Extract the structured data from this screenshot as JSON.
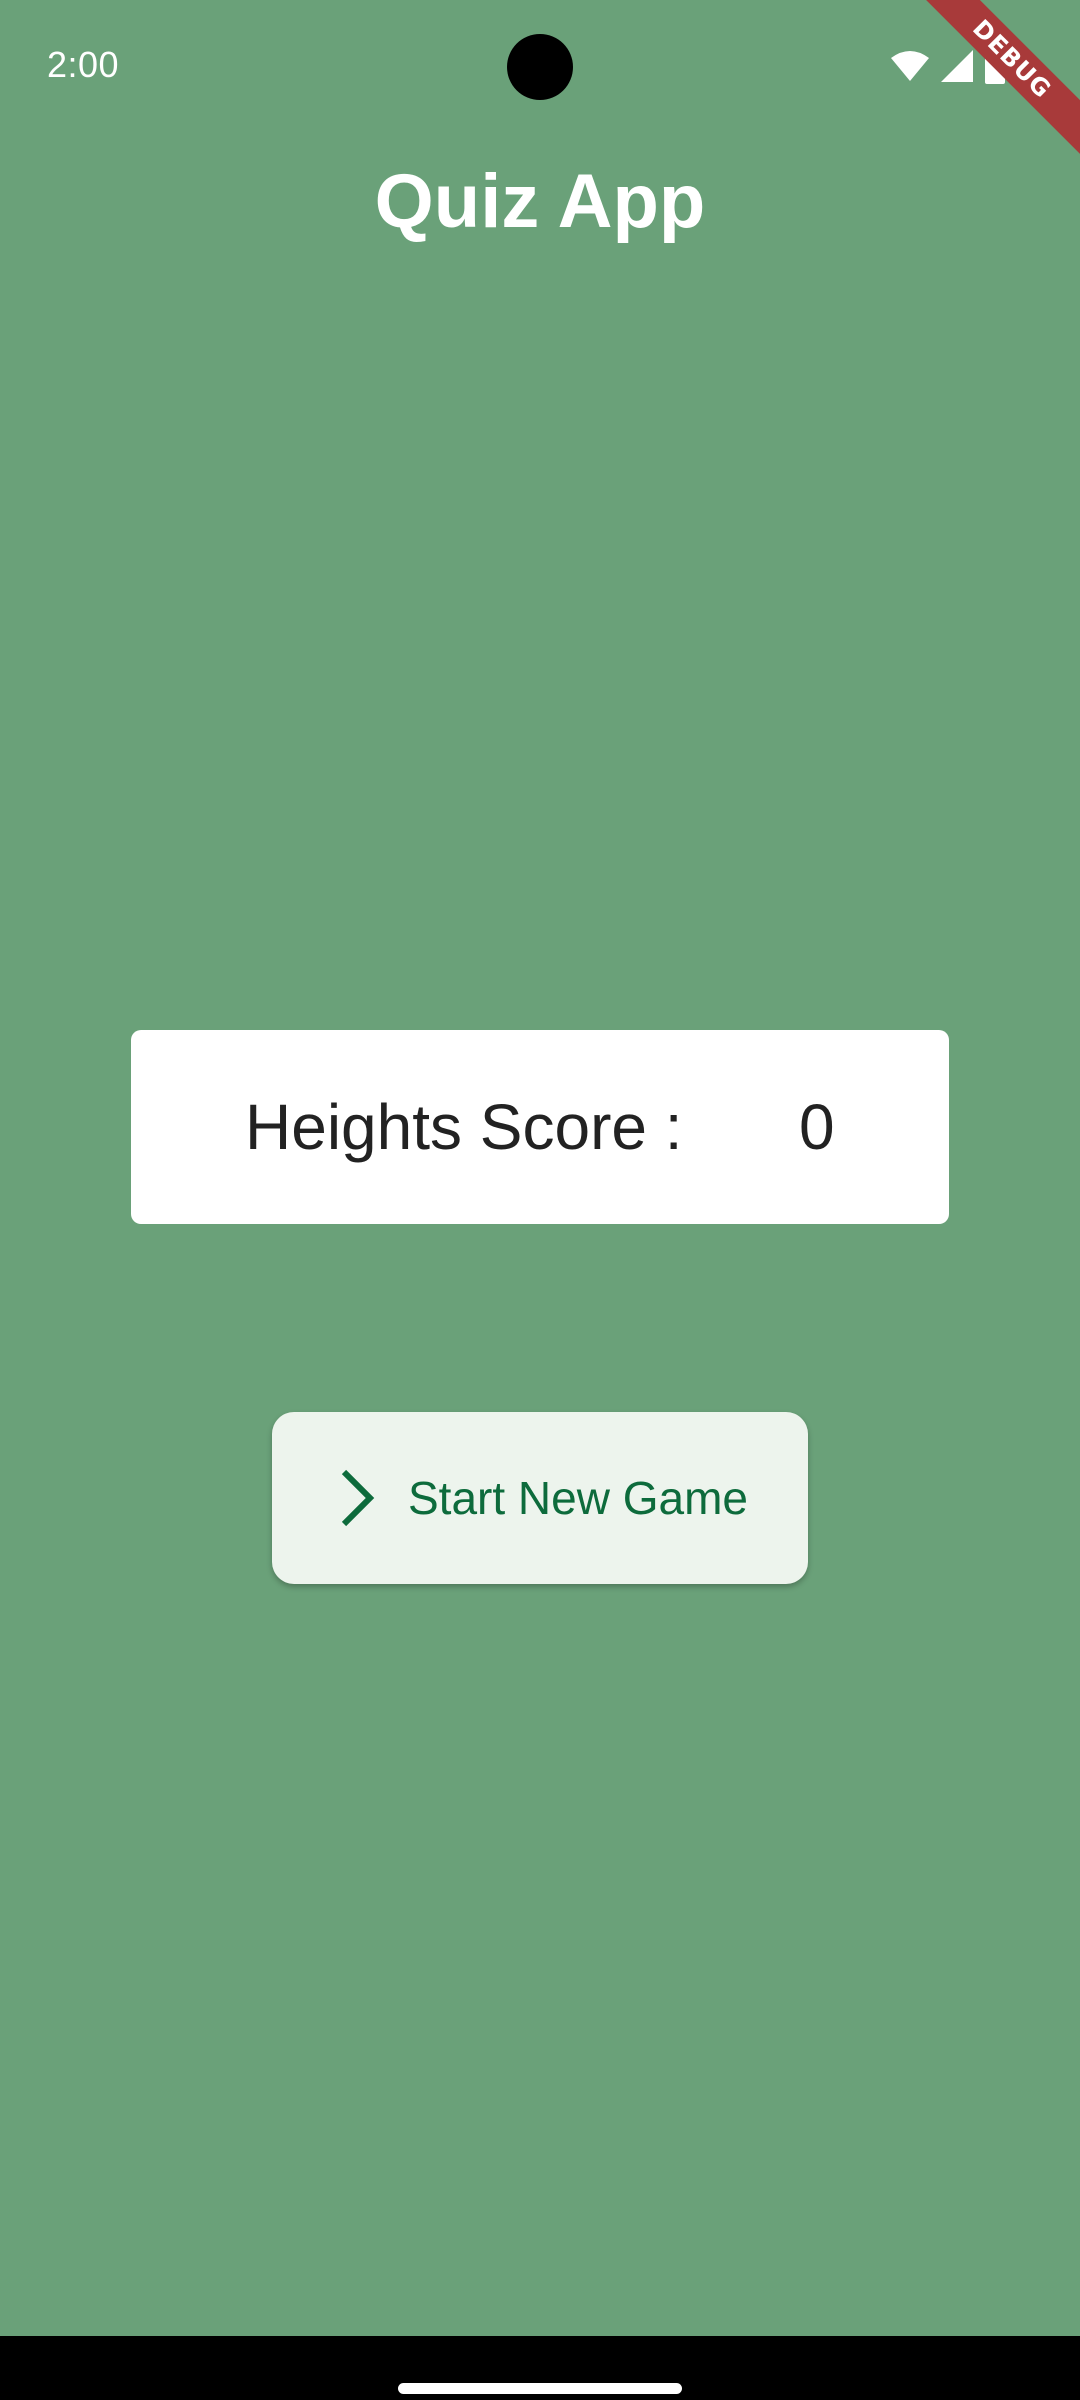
{
  "status_bar": {
    "time": "2:00",
    "icons": [
      "wifi-icon",
      "cellular-signal-icon",
      "battery-icon"
    ]
  },
  "debug_banner": "DEBUG",
  "app": {
    "title": "Quiz App"
  },
  "score_card": {
    "label": "Heights Score :",
    "value": "0"
  },
  "start_button": {
    "label": "Start New Game",
    "icon": "chevron-right-icon"
  },
  "colors": {
    "background": "#6aa179",
    "card": "#ffffff",
    "button_bg": "#edf4ed",
    "button_text": "#0d6b3c",
    "debug_ribbon": "#a83a3a"
  }
}
